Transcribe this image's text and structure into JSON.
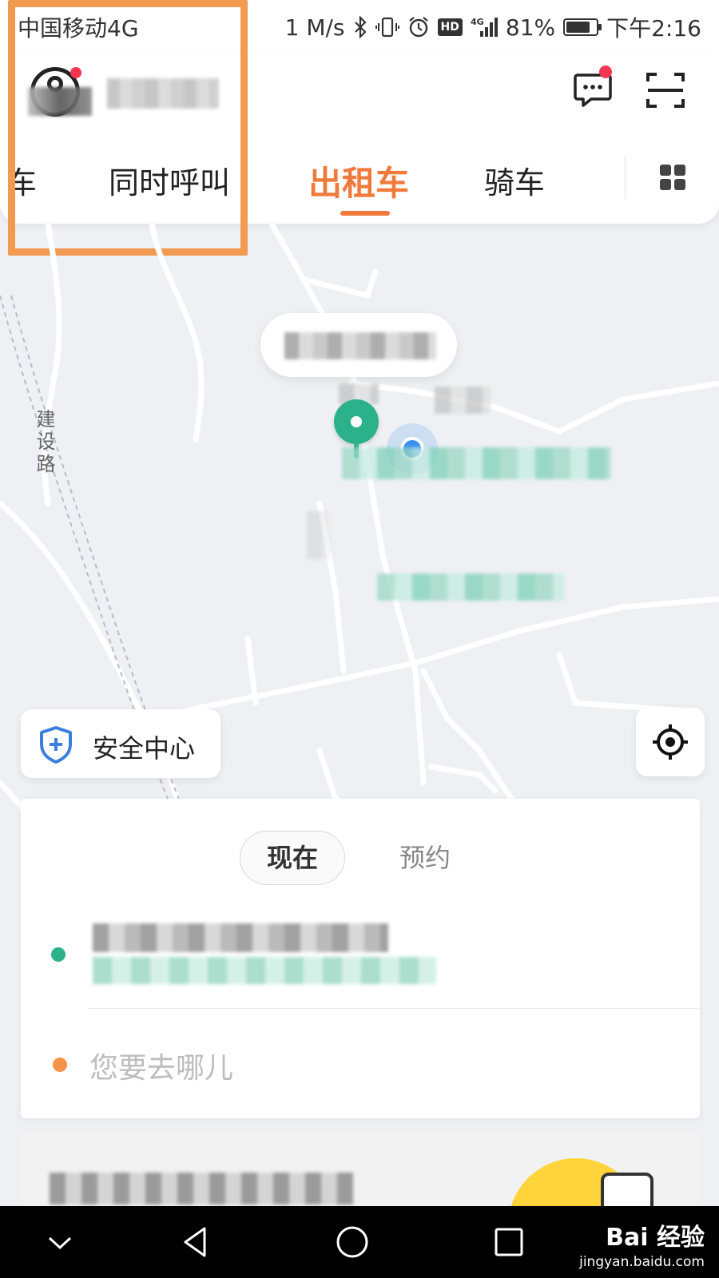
{
  "status_bar": {
    "carrier": "中国移动4G",
    "speed": "1 M/s",
    "hd_badge": "HD",
    "network": "4G",
    "battery": "81%",
    "battery_level": 0.81,
    "time": "下午2:16"
  },
  "header": {
    "tabs": [
      {
        "label": "车",
        "active": false
      },
      {
        "label": "同时呼叫",
        "active": false
      },
      {
        "label": "出租车",
        "active": true
      },
      {
        "label": "骑车",
        "active": false
      }
    ]
  },
  "map": {
    "road_label": "建设路"
  },
  "safety": {
    "label": "安全中心"
  },
  "ride_panel": {
    "time_tabs": [
      {
        "label": "现在",
        "selected": true
      },
      {
        "label": "预约",
        "selected": false
      }
    ],
    "destination_placeholder": "您要去哪儿"
  },
  "watermark": {
    "title": "Bai 经验",
    "url": "jingyan.baidu.com"
  },
  "colors": {
    "accent": "#f07a3c",
    "pickup_green": "#2cb28b",
    "location_blue": "#3a8ef0",
    "highlight_orange": "#f29a50"
  }
}
